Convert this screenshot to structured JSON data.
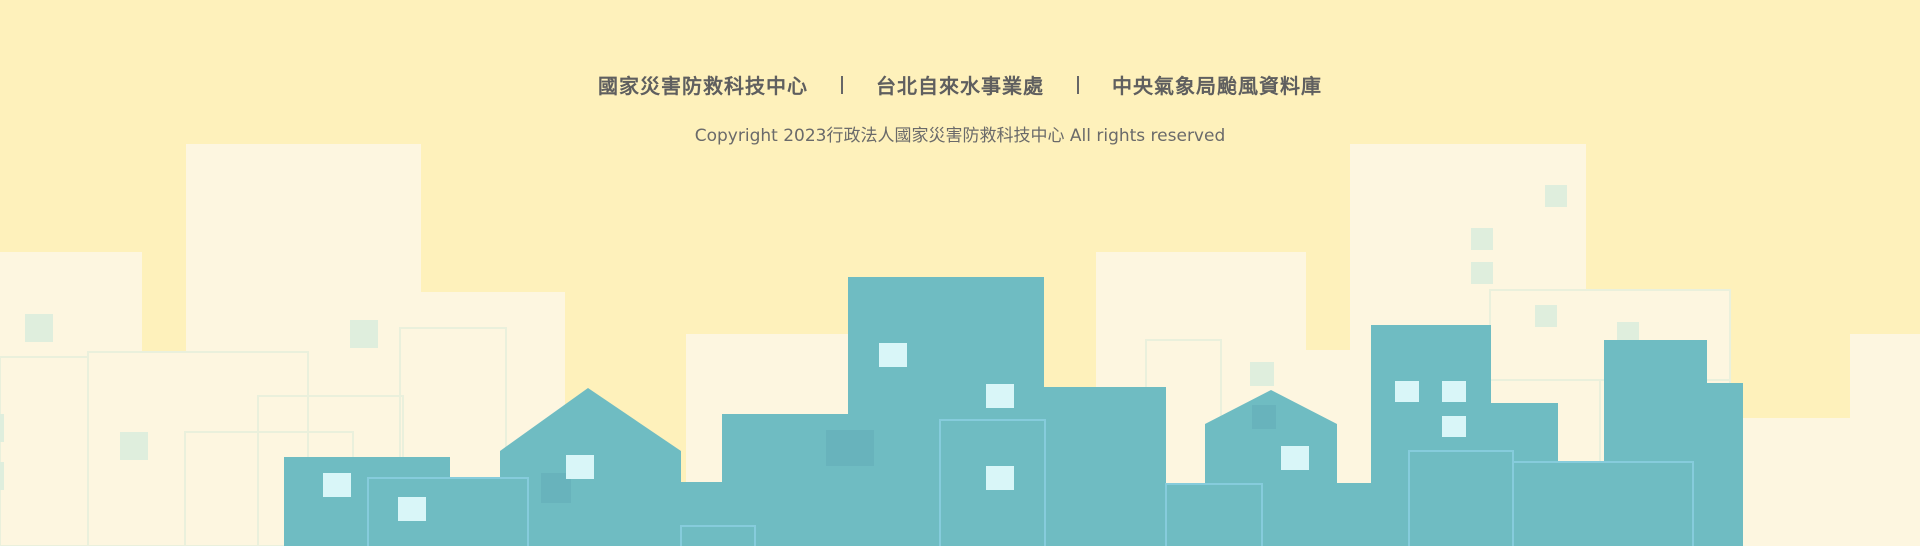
{
  "footer": {
    "links": [
      {
        "label": "國家災害防救科技中心"
      },
      {
        "label": "台北自來水事業處"
      },
      {
        "label": "中央氣象局颱風資料庫"
      }
    ],
    "copyright": "Copyright 2023行政法人國家災害防救科技中心 All rights reserved"
  },
  "colors": {
    "sky": "#fef1bb",
    "pale_building": "#fdf6e0",
    "teal_building": "#6fbcc2",
    "window_light": "#d9f6f8",
    "window_pale": "#dfeedd"
  }
}
